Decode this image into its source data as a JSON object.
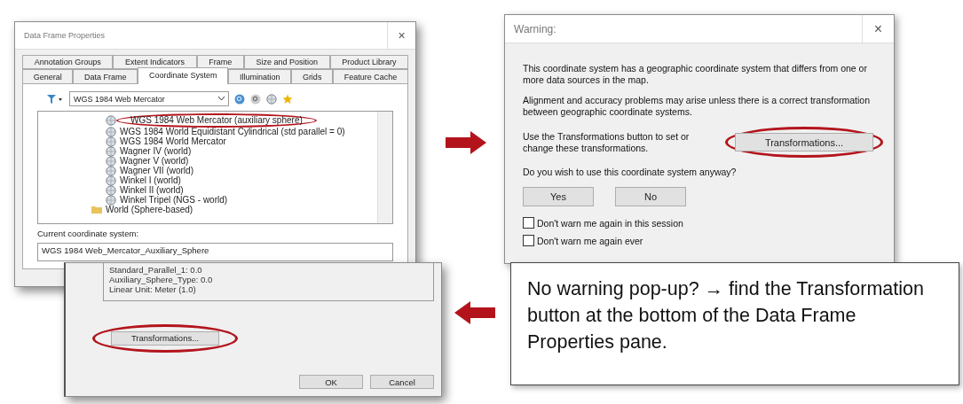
{
  "properties_dialog": {
    "title": "Data Frame Properties",
    "close": "×",
    "tab_rows": [
      [
        {
          "label": "Annotation Groups",
          "selected": false
        },
        {
          "label": "Extent Indicators",
          "selected": false
        },
        {
          "label": "Frame",
          "selected": false
        },
        {
          "label": "Size and Position",
          "selected": false
        },
        {
          "label": "Product Library",
          "selected": false
        }
      ],
      [
        {
          "label": "General",
          "selected": false
        },
        {
          "label": "Data Frame",
          "selected": false
        },
        {
          "label": "Coordinate System",
          "selected": true
        },
        {
          "label": "Illumination",
          "selected": false
        },
        {
          "label": "Grids",
          "selected": false
        },
        {
          "label": "Feature Cache",
          "selected": false
        }
      ]
    ],
    "dropdown": "WGS 1984 Web Mercator",
    "tree": [
      {
        "kind": "projection",
        "label": "WGS 1984 Web Mercator (auxiliary sphere)",
        "circled": true
      },
      {
        "kind": "projection",
        "label": "WGS 1984 World Equidistant Cylindrical (std parallel = 0)",
        "circled": false
      },
      {
        "kind": "projection",
        "label": "WGS 1984 World Mercator",
        "circled": false
      },
      {
        "kind": "projection",
        "label": "Wagner IV (world)",
        "circled": false
      },
      {
        "kind": "projection",
        "label": "Wagner V (world)",
        "circled": false
      },
      {
        "kind": "projection",
        "label": "Wagner VII (world)",
        "circled": false
      },
      {
        "kind": "projection",
        "label": "Winkel I (world)",
        "circled": false
      },
      {
        "kind": "projection",
        "label": "Winkel II (world)",
        "circled": false
      },
      {
        "kind": "projection",
        "label": "Winkel Tripel (NGS - world)",
        "circled": false
      },
      {
        "kind": "folder",
        "label": "World (Sphere-based)",
        "circled": false
      }
    ],
    "current_label": "Current coordinate system:",
    "current_value": "WGS 1984 Web_Mercator_Auxiliary_Sphere"
  },
  "transformations_panel": {
    "details": [
      "Standard_Parallel_1: 0.0",
      "Auxiliary_Sphere_Type: 0.0",
      "Linear Unit: Meter (1.0)"
    ],
    "button": "Transformations...",
    "circled": true,
    "ok": "OK",
    "cancel": "Cancel"
  },
  "warning_dialog": {
    "title": "Warning:",
    "close": "×",
    "paragraphs": [
      "This coordinate system has a geographic coordinate system that differs from one or more data sources in the map.",
      "Alignment and accuracy problems may arise unless there is a correct transformation between geographic coordinate systems."
    ],
    "hint": "Use the Transformations button to set or change these transformations.",
    "button": "Transformations...",
    "circled": true,
    "question": "Do you wish to use this coordinate system anyway?",
    "buttons": [
      "Yes",
      "No"
    ],
    "checkboxes": [
      {
        "label": "Don't warn me again in this session",
        "checked": false
      },
      {
        "label": "Don't warn me again ever",
        "checked": false
      }
    ]
  },
  "callout": {
    "text": "No warning pop-up? → find the Transformation button at the bottom of the Data Frame Properties pane."
  }
}
